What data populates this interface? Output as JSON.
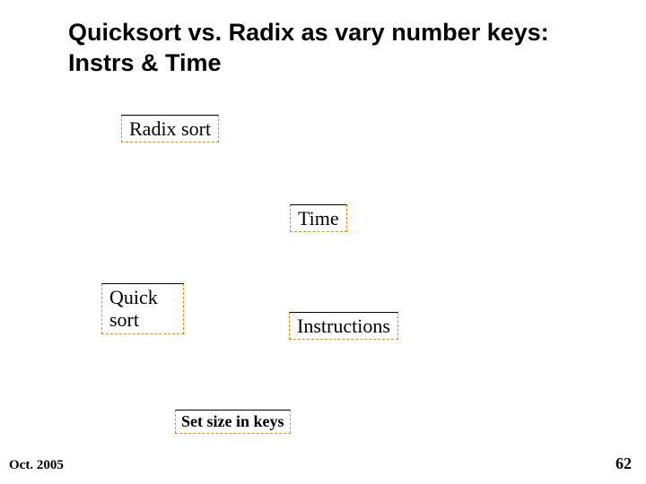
{
  "title": "Quicksort vs. Radix as vary number keys:\nInstrs & Time",
  "labels": {
    "radix": "Radix sort",
    "time": "Time",
    "quick": "Quick\nsort",
    "instructions": "Instructions",
    "set_size": "Set size in keys"
  },
  "footer": {
    "date": "Oct. 2005",
    "page": "62"
  }
}
